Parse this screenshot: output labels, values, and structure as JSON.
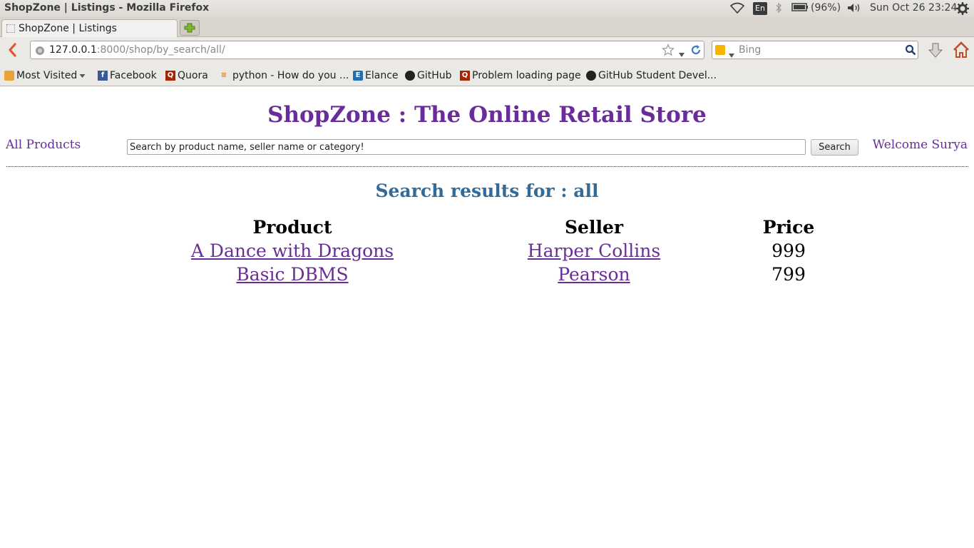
{
  "system_panel": {
    "window_title": "ShopZone | Listings - Mozilla Firefox",
    "language": "En",
    "battery": "(96%)",
    "datetime": "Sun Oct 26 23:24"
  },
  "browser": {
    "tab_title": "ShopZone | Listings",
    "url_host": "127.0.0.1",
    "url_rest": ":8000/shop/by_search/all/",
    "search_engine": "Bing",
    "bookmarks": [
      {
        "label": "Most Visited",
        "icon": "most-visited-icon"
      },
      {
        "label": "Facebook",
        "icon": "facebook-icon"
      },
      {
        "label": "Quora",
        "icon": "quora-icon"
      },
      {
        "label": "python - How do you ...",
        "icon": "stackoverflow-icon"
      },
      {
        "label": "Elance",
        "icon": "elance-icon"
      },
      {
        "label": "GitHub",
        "icon": "github-icon"
      },
      {
        "label": "Problem loading page",
        "icon": "quora-icon"
      },
      {
        "label": "GitHub Student Devel...",
        "icon": "github-icon"
      }
    ]
  },
  "page": {
    "site_title": "ShopZone : The Online Retail Store",
    "nav": {
      "all_products": "All Products",
      "search_placeholder": "Search by product name, seller name or category!",
      "search_button": "Search",
      "welcome": "Welcome Surya"
    },
    "results_heading": "Search results for : all",
    "table": {
      "headers": {
        "product": "Product",
        "seller": "Seller",
        "price": "Price"
      },
      "rows": [
        {
          "product": "A Dance with Dragons",
          "seller": "Harper Collins",
          "price": "999"
        },
        {
          "product": "Basic DBMS",
          "seller": "Pearson",
          "price": "799"
        }
      ]
    }
  },
  "colors": {
    "title_purple": "#6a2c9a",
    "heading_blue": "#326a99"
  }
}
